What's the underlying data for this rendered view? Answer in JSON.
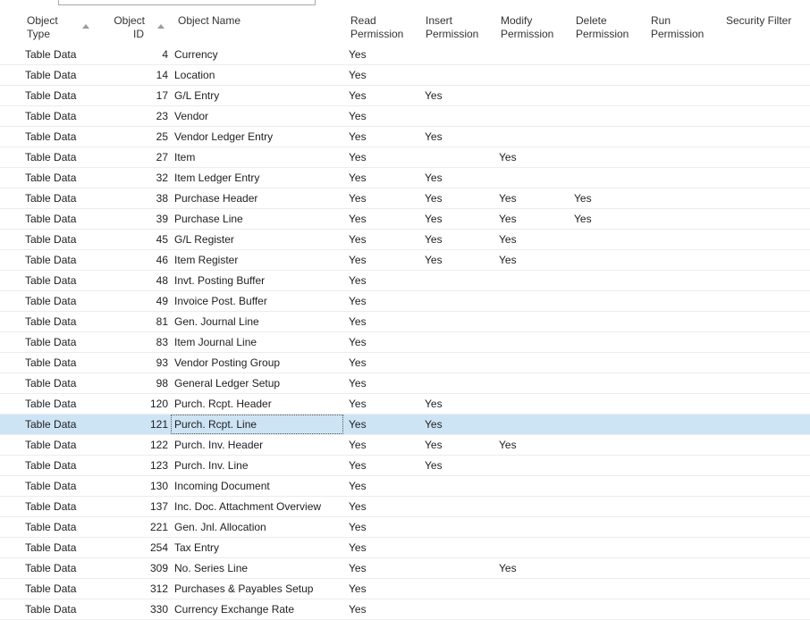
{
  "columns": {
    "object_type": [
      "Object",
      "Type"
    ],
    "object_id": [
      "Object",
      "ID"
    ],
    "object_name": "Object Name",
    "read": [
      "Read",
      "Permission"
    ],
    "insert": [
      "Insert",
      "Permission"
    ],
    "modify": [
      "Modify",
      "Permission"
    ],
    "delete": [
      "Delete",
      "Permission"
    ],
    "run": [
      "Run",
      "Permission"
    ],
    "security_filter": "Security Filter"
  },
  "selected_row_index": 18,
  "rows": [
    {
      "type": "Table Data",
      "id": "4",
      "name": "Currency",
      "read": "Yes",
      "insert": "",
      "modify": "",
      "delete": "",
      "run": "",
      "filter": ""
    },
    {
      "type": "Table Data",
      "id": "14",
      "name": "Location",
      "read": "Yes",
      "insert": "",
      "modify": "",
      "delete": "",
      "run": "",
      "filter": ""
    },
    {
      "type": "Table Data",
      "id": "17",
      "name": "G/L Entry",
      "read": "Yes",
      "insert": "Yes",
      "modify": "",
      "delete": "",
      "run": "",
      "filter": ""
    },
    {
      "type": "Table Data",
      "id": "23",
      "name": "Vendor",
      "read": "Yes",
      "insert": "",
      "modify": "",
      "delete": "",
      "run": "",
      "filter": ""
    },
    {
      "type": "Table Data",
      "id": "25",
      "name": "Vendor Ledger Entry",
      "read": "Yes",
      "insert": "Yes",
      "modify": "",
      "delete": "",
      "run": "",
      "filter": ""
    },
    {
      "type": "Table Data",
      "id": "27",
      "name": "Item",
      "read": "Yes",
      "insert": "",
      "modify": "Yes",
      "delete": "",
      "run": "",
      "filter": ""
    },
    {
      "type": "Table Data",
      "id": "32",
      "name": "Item Ledger Entry",
      "read": "Yes",
      "insert": "Yes",
      "modify": "",
      "delete": "",
      "run": "",
      "filter": ""
    },
    {
      "type": "Table Data",
      "id": "38",
      "name": "Purchase Header",
      "read": "Yes",
      "insert": "Yes",
      "modify": "Yes",
      "delete": "Yes",
      "run": "",
      "filter": ""
    },
    {
      "type": "Table Data",
      "id": "39",
      "name": "Purchase Line",
      "read": "Yes",
      "insert": "Yes",
      "modify": "Yes",
      "delete": "Yes",
      "run": "",
      "filter": ""
    },
    {
      "type": "Table Data",
      "id": "45",
      "name": "G/L Register",
      "read": "Yes",
      "insert": "Yes",
      "modify": "Yes",
      "delete": "",
      "run": "",
      "filter": ""
    },
    {
      "type": "Table Data",
      "id": "46",
      "name": "Item Register",
      "read": "Yes",
      "insert": "Yes",
      "modify": "Yes",
      "delete": "",
      "run": "",
      "filter": ""
    },
    {
      "type": "Table Data",
      "id": "48",
      "name": "Invt. Posting Buffer",
      "read": "Yes",
      "insert": "",
      "modify": "",
      "delete": "",
      "run": "",
      "filter": ""
    },
    {
      "type": "Table Data",
      "id": "49",
      "name": "Invoice Post. Buffer",
      "read": "Yes",
      "insert": "",
      "modify": "",
      "delete": "",
      "run": "",
      "filter": ""
    },
    {
      "type": "Table Data",
      "id": "81",
      "name": "Gen. Journal Line",
      "read": "Yes",
      "insert": "",
      "modify": "",
      "delete": "",
      "run": "",
      "filter": ""
    },
    {
      "type": "Table Data",
      "id": "83",
      "name": "Item Journal Line",
      "read": "Yes",
      "insert": "",
      "modify": "",
      "delete": "",
      "run": "",
      "filter": ""
    },
    {
      "type": "Table Data",
      "id": "93",
      "name": "Vendor Posting Group",
      "read": "Yes",
      "insert": "",
      "modify": "",
      "delete": "",
      "run": "",
      "filter": ""
    },
    {
      "type": "Table Data",
      "id": "98",
      "name": "General Ledger Setup",
      "read": "Yes",
      "insert": "",
      "modify": "",
      "delete": "",
      "run": "",
      "filter": ""
    },
    {
      "type": "Table Data",
      "id": "120",
      "name": "Purch. Rcpt. Header",
      "read": "Yes",
      "insert": "Yes",
      "modify": "",
      "delete": "",
      "run": "",
      "filter": ""
    },
    {
      "type": "Table Data",
      "id": "121",
      "name": "Purch. Rcpt. Line",
      "read": "Yes",
      "insert": "Yes",
      "modify": "",
      "delete": "",
      "run": "",
      "filter": ""
    },
    {
      "type": "Table Data",
      "id": "122",
      "name": "Purch. Inv. Header",
      "read": "Yes",
      "insert": "Yes",
      "modify": "Yes",
      "delete": "",
      "run": "",
      "filter": ""
    },
    {
      "type": "Table Data",
      "id": "123",
      "name": "Purch. Inv. Line",
      "read": "Yes",
      "insert": "Yes",
      "modify": "",
      "delete": "",
      "run": "",
      "filter": ""
    },
    {
      "type": "Table Data",
      "id": "130",
      "name": "Incoming Document",
      "read": "Yes",
      "insert": "",
      "modify": "",
      "delete": "",
      "run": "",
      "filter": ""
    },
    {
      "type": "Table Data",
      "id": "137",
      "name": "Inc. Doc. Attachment Overview",
      "read": "Yes",
      "insert": "",
      "modify": "",
      "delete": "",
      "run": "",
      "filter": ""
    },
    {
      "type": "Table Data",
      "id": "221",
      "name": "Gen. Jnl. Allocation",
      "read": "Yes",
      "insert": "",
      "modify": "",
      "delete": "",
      "run": "",
      "filter": ""
    },
    {
      "type": "Table Data",
      "id": "254",
      "name": "Tax Entry",
      "read": "Yes",
      "insert": "",
      "modify": "",
      "delete": "",
      "run": "",
      "filter": ""
    },
    {
      "type": "Table Data",
      "id": "309",
      "name": "No. Series Line",
      "read": "Yes",
      "insert": "",
      "modify": "Yes",
      "delete": "",
      "run": "",
      "filter": ""
    },
    {
      "type": "Table Data",
      "id": "312",
      "name": "Purchases & Payables Setup",
      "read": "Yes",
      "insert": "",
      "modify": "",
      "delete": "",
      "run": "",
      "filter": ""
    },
    {
      "type": "Table Data",
      "id": "330",
      "name": "Currency Exchange Rate",
      "read": "Yes",
      "insert": "",
      "modify": "",
      "delete": "",
      "run": "",
      "filter": ""
    }
  ]
}
